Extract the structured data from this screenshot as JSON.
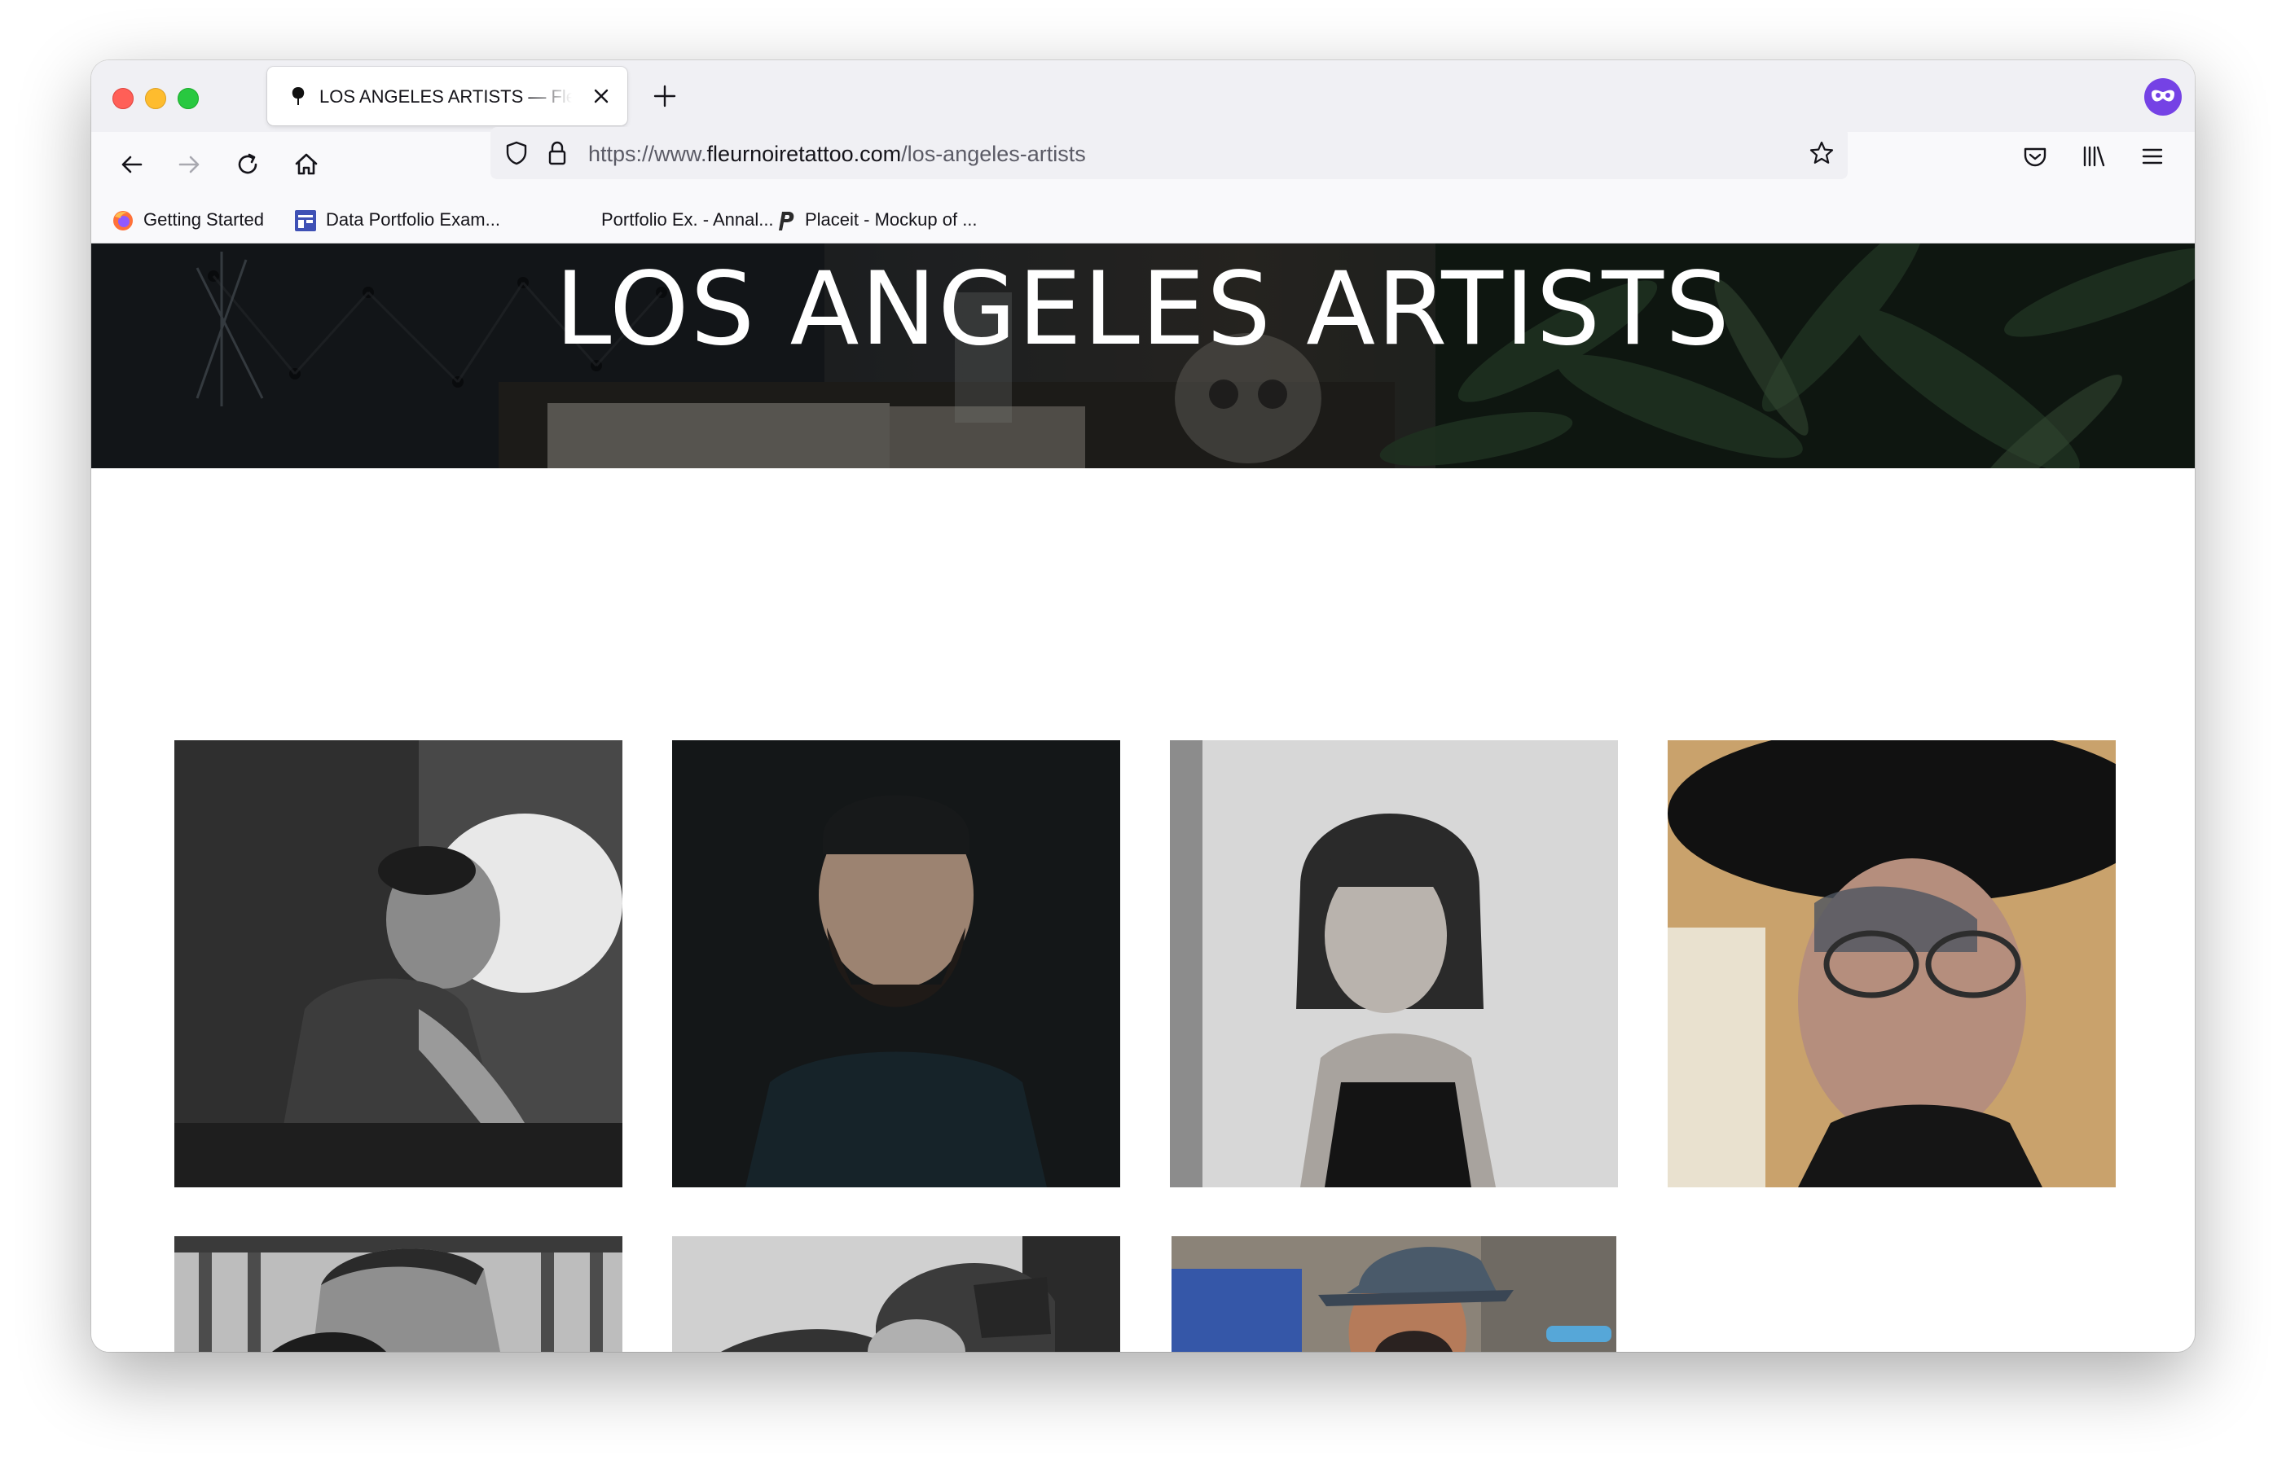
{
  "browser": {
    "tab": {
      "title": "LOS ANGELES ARTISTS — Fleur Noire Tattoo"
    },
    "url": {
      "prefix": "https://www.",
      "domain": "fleurnoiretattoo.com",
      "path": "/los-angeles-artists"
    },
    "bookmarks": [
      {
        "label": "Getting Started",
        "icon": "firefox-icon"
      },
      {
        "label": "Data Portfolio Exam...",
        "icon": "layout-icon"
      },
      {
        "label": "Portfolio Ex. - Annal...",
        "icon": "none"
      },
      {
        "label": "Placeit - Mockup of ...",
        "icon": "placeit-icon"
      }
    ],
    "colors": {
      "tabstrip": "#f0f0f4",
      "toolbar": "#f9f9fb",
      "extension": "#7542e5"
    }
  },
  "page": {
    "hero_title": "LOS ANGELES ARTISTS",
    "artists": [
      {
        "photo": "artist working on tattoo, black and white"
      },
      {
        "photo": "bearded man in cap, dark background"
      },
      {
        "photo": "woman with bob haircut, black and white"
      },
      {
        "photo": "tattooed man in black hat and glasses"
      },
      {
        "photo": "man with undercut, black and white"
      },
      {
        "photo": "man in Salty Crew cap"
      },
      {
        "photo": "man in fedora tattooing"
      }
    ]
  }
}
